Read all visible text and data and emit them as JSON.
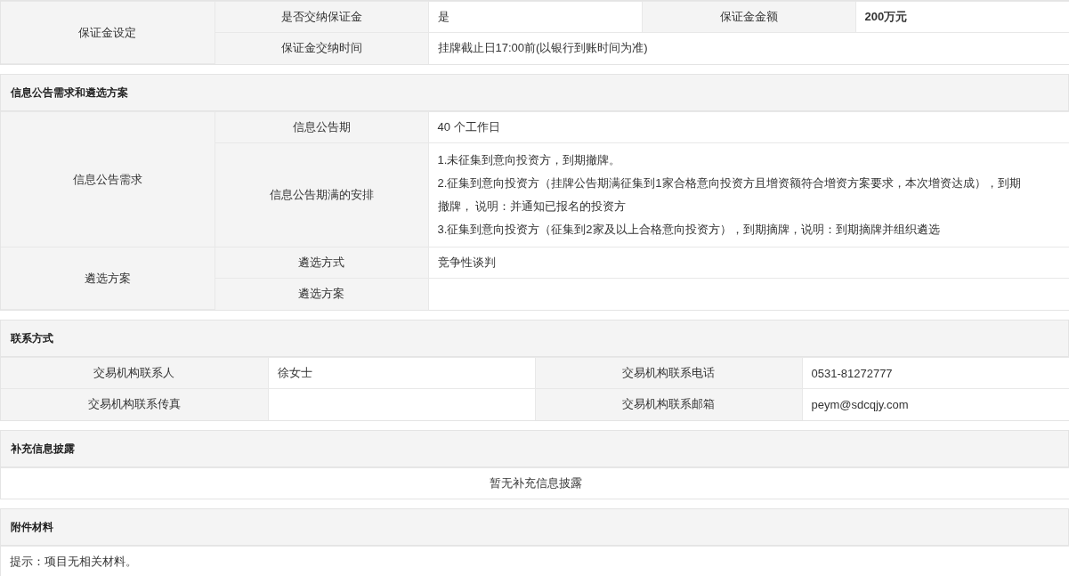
{
  "sections": [
    {
      "rows": [
        [
          {
            "kind": "label",
            "text": "保证金设定",
            "rowspan": 2
          },
          {
            "kind": "label",
            "text": "是否交纳保证金"
          },
          {
            "kind": "value",
            "text": "是"
          },
          {
            "kind": "label",
            "text": "保证金金额"
          },
          {
            "kind": "value",
            "text": "200万元",
            "bold": true
          }
        ],
        [
          {
            "kind": "label",
            "text": "保证金交纳时间"
          },
          {
            "kind": "value",
            "text": "挂牌截止日17:00前(以银行到账时间为准)",
            "colspan": 3
          }
        ]
      ]
    },
    {
      "title": "信息公告需求和遴选方案",
      "rows": [
        [
          {
            "kind": "label",
            "text": "信息公告需求",
            "rowspan": 2
          },
          {
            "kind": "label",
            "text": "信息公告期"
          },
          {
            "kind": "value",
            "text": "40 个工作日"
          }
        ],
        [
          {
            "kind": "label",
            "text": "信息公告期满的安排"
          },
          {
            "kind": "value",
            "lines": [
              "1.未征集到意向投资方，到期撤牌。",
              "2.征集到意向投资方（挂牌公告期满征集到1家合格意向投资方且增资额符合增资方案要求，本次增资达成），到期撤牌， 说明：并通知已报名的投资方",
              "3.征集到意向投资方（征集到2家及以上合格意向投资方），到期摘牌，说明：到期摘牌并组织遴选"
            ]
          }
        ],
        [
          {
            "kind": "label",
            "text": "遴选方案",
            "rowspan": 2
          },
          {
            "kind": "label",
            "text": "遴选方式"
          },
          {
            "kind": "value",
            "text": "竞争性谈判"
          }
        ],
        [
          {
            "kind": "label",
            "text": "遴选方案"
          },
          {
            "kind": "value"
          }
        ]
      ]
    },
    {
      "title": "联系方式",
      "rows": [
        [
          {
            "kind": "label",
            "text": "交易机构联系人"
          },
          {
            "kind": "value",
            "text": "徐女士"
          },
          {
            "kind": "label",
            "text": "交易机构联系电话"
          },
          {
            "kind": "value",
            "text": "0531-81272777"
          }
        ],
        [
          {
            "kind": "label",
            "text": "交易机构联系传真"
          },
          {
            "kind": "value"
          },
          {
            "kind": "label",
            "text": "交易机构联系邮箱"
          },
          {
            "kind": "value",
            "text": "peym@sdcqjy.com"
          }
        ]
      ]
    },
    {
      "title": "补充信息披露",
      "rows": [
        [
          {
            "kind": "empty",
            "text": "暂无补充信息披露"
          }
        ]
      ]
    },
    {
      "title": "附件材料",
      "rows": [
        [
          {
            "kind": "value",
            "text": "提示：项目无相关材料。"
          }
        ]
      ]
    }
  ]
}
